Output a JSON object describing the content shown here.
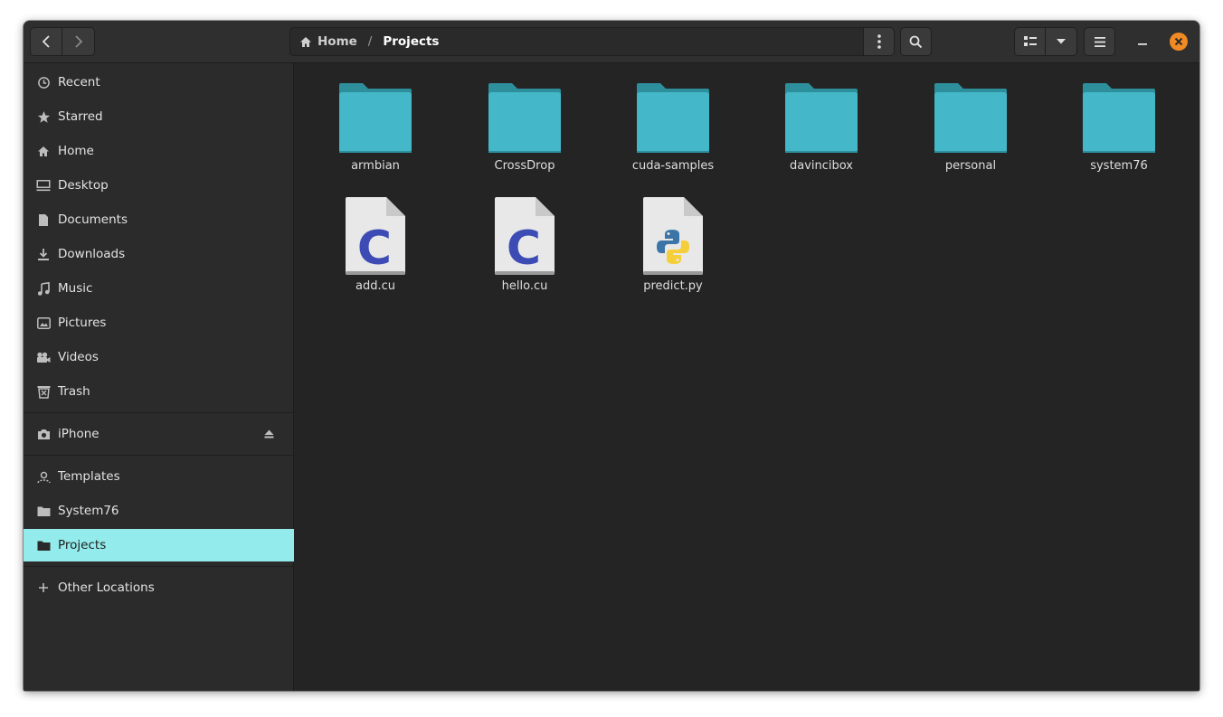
{
  "header": {
    "breadcrumb": [
      {
        "label": "Home",
        "icon": "home-icon"
      },
      {
        "label": "Projects"
      }
    ],
    "separator": "/"
  },
  "sidebar": {
    "places": [
      {
        "label": "Recent",
        "icon": "clock-icon"
      },
      {
        "label": "Starred",
        "icon": "star-icon"
      },
      {
        "label": "Home",
        "icon": "home-icon"
      },
      {
        "label": "Desktop",
        "icon": "desktop-icon"
      },
      {
        "label": "Documents",
        "icon": "document-icon"
      },
      {
        "label": "Downloads",
        "icon": "download-icon"
      },
      {
        "label": "Music",
        "icon": "music-icon"
      },
      {
        "label": "Pictures",
        "icon": "picture-icon"
      },
      {
        "label": "Videos",
        "icon": "video-icon"
      },
      {
        "label": "Trash",
        "icon": "trash-icon"
      }
    ],
    "devices": [
      {
        "label": "iPhone",
        "icon": "camera-icon"
      }
    ],
    "bookmarks": [
      {
        "label": "Templates",
        "icon": "templates-icon"
      },
      {
        "label": "System76",
        "icon": "folder-icon"
      },
      {
        "label": "Projects",
        "icon": "folder-icon",
        "active": true
      }
    ],
    "other": {
      "label": "Other Locations",
      "icon": "plus-icon"
    }
  },
  "files": [
    {
      "name": "armbian",
      "type": "folder"
    },
    {
      "name": "CrossDrop",
      "type": "folder"
    },
    {
      "name": "cuda-samples",
      "type": "folder"
    },
    {
      "name": "davincibox",
      "type": "folder"
    },
    {
      "name": "personal",
      "type": "folder"
    },
    {
      "name": "system76",
      "type": "folder"
    },
    {
      "name": "add.cu",
      "type": "c-source"
    },
    {
      "name": "hello.cu",
      "type": "c-source"
    },
    {
      "name": "predict.py",
      "type": "python"
    }
  ],
  "colors": {
    "folder": "#44b8c8",
    "folder_tab": "#2e8f9c",
    "accent_active": "#94ebeb",
    "close": "#f08a24",
    "c_letter": "#3d4cb5"
  }
}
